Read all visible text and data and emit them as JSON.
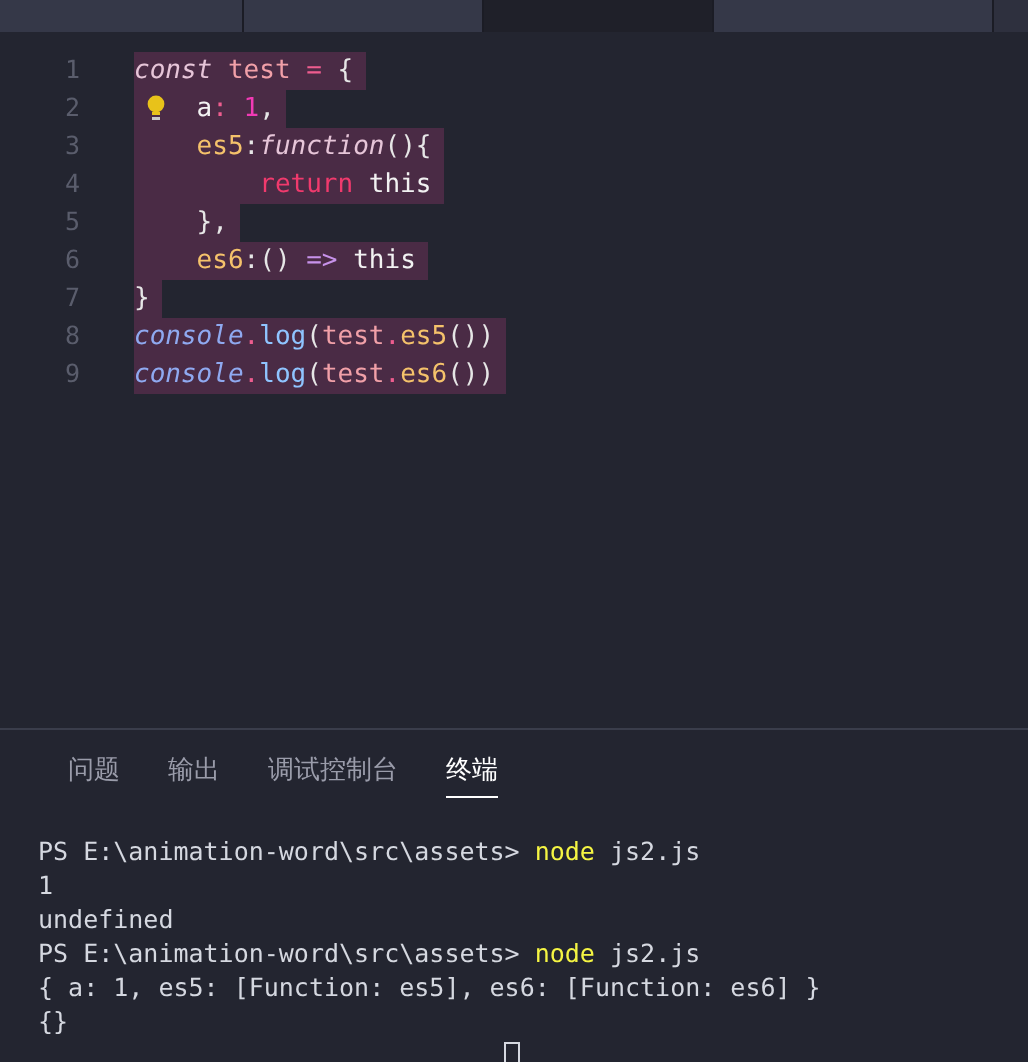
{
  "editor_tabs": [
    {
      "selected": false
    },
    {
      "selected": false
    },
    {
      "selected": true
    },
    {
      "selected": false
    }
  ],
  "code_lines": [
    {
      "number": "1",
      "selected": true,
      "tokens": [
        {
          "text": "const",
          "kind": "storage"
        },
        {
          "text": " test ",
          "kind": "variable"
        },
        {
          "text": "=",
          "kind": "operator"
        },
        {
          "text": " {",
          "kind": "punct"
        }
      ]
    },
    {
      "number": "2",
      "selected": true,
      "lightbulb": true,
      "tokens": [
        {
          "text": "    a",
          "kind": "plain"
        },
        {
          "text": ":",
          "kind": "operator"
        },
        {
          "text": " 1",
          "kind": "number"
        },
        {
          "text": ",",
          "kind": "punct"
        }
      ]
    },
    {
      "number": "3",
      "selected": true,
      "tokens": [
        {
          "text": "    es5",
          "kind": "property"
        },
        {
          "text": ":",
          "kind": "punct"
        },
        {
          "text": "function",
          "kind": "storage"
        },
        {
          "text": "(){",
          "kind": "punct"
        }
      ]
    },
    {
      "number": "4",
      "selected": true,
      "tokens": [
        {
          "text": "        return",
          "kind": "keyword"
        },
        {
          "text": " this",
          "kind": "plain"
        }
      ]
    },
    {
      "number": "5",
      "selected": true,
      "tokens": [
        {
          "text": "    },",
          "kind": "punct"
        }
      ]
    },
    {
      "number": "6",
      "selected": true,
      "tokens": [
        {
          "text": "    es6",
          "kind": "property"
        },
        {
          "text": ":() ",
          "kind": "punct"
        },
        {
          "text": "=>",
          "kind": "storage_plain"
        },
        {
          "text": " this",
          "kind": "plain"
        }
      ]
    },
    {
      "number": "7",
      "selected": true,
      "tokens": [
        {
          "text": "}",
          "kind": "punct"
        }
      ]
    },
    {
      "number": "8",
      "selected": true,
      "tokens": [
        {
          "text": "console",
          "kind": "support"
        },
        {
          "text": ".",
          "kind": "operator"
        },
        {
          "text": "log",
          "kind": "function"
        },
        {
          "text": "(",
          "kind": "punct"
        },
        {
          "text": "test",
          "kind": "variable"
        },
        {
          "text": ".",
          "kind": "operator"
        },
        {
          "text": "es5",
          "kind": "property"
        },
        {
          "text": "())",
          "kind": "punct"
        }
      ]
    },
    {
      "number": "9",
      "selected": true,
      "tokens": [
        {
          "text": "console",
          "kind": "support"
        },
        {
          "text": ".",
          "kind": "operator"
        },
        {
          "text": "log",
          "kind": "function"
        },
        {
          "text": "(",
          "kind": "punct"
        },
        {
          "text": "test",
          "kind": "variable"
        },
        {
          "text": ".",
          "kind": "operator"
        },
        {
          "text": "es6",
          "kind": "property"
        },
        {
          "text": "())",
          "kind": "punct"
        }
      ]
    }
  ],
  "panel_tabs": [
    {
      "label": "问题",
      "selected": false
    },
    {
      "label": "输出",
      "selected": false
    },
    {
      "label": "调试控制台",
      "selected": false
    },
    {
      "label": "终端",
      "selected": true
    }
  ],
  "terminal_lines": [
    {
      "segments": [
        {
          "text": "PS E:\\animation-word\\src\\assets> ",
          "kind": "output"
        },
        {
          "text": "node",
          "kind": "command"
        },
        {
          "text": " js2.js",
          "kind": "output"
        }
      ]
    },
    {
      "segments": [
        {
          "text": "1",
          "kind": "output"
        }
      ]
    },
    {
      "segments": [
        {
          "text": "undefined",
          "kind": "output"
        }
      ]
    },
    {
      "segments": [
        {
          "text": "PS E:\\animation-word\\src\\assets> ",
          "kind": "output"
        },
        {
          "text": "node",
          "kind": "command"
        },
        {
          "text": " js2.js",
          "kind": "output"
        }
      ]
    },
    {
      "segments": [
        {
          "text": "{ a: 1, es5: [Function: es5], es6: [Function: es6] }",
          "kind": "output"
        }
      ]
    },
    {
      "segments": [
        {
          "text": "{}",
          "kind": "output"
        }
      ]
    }
  ]
}
